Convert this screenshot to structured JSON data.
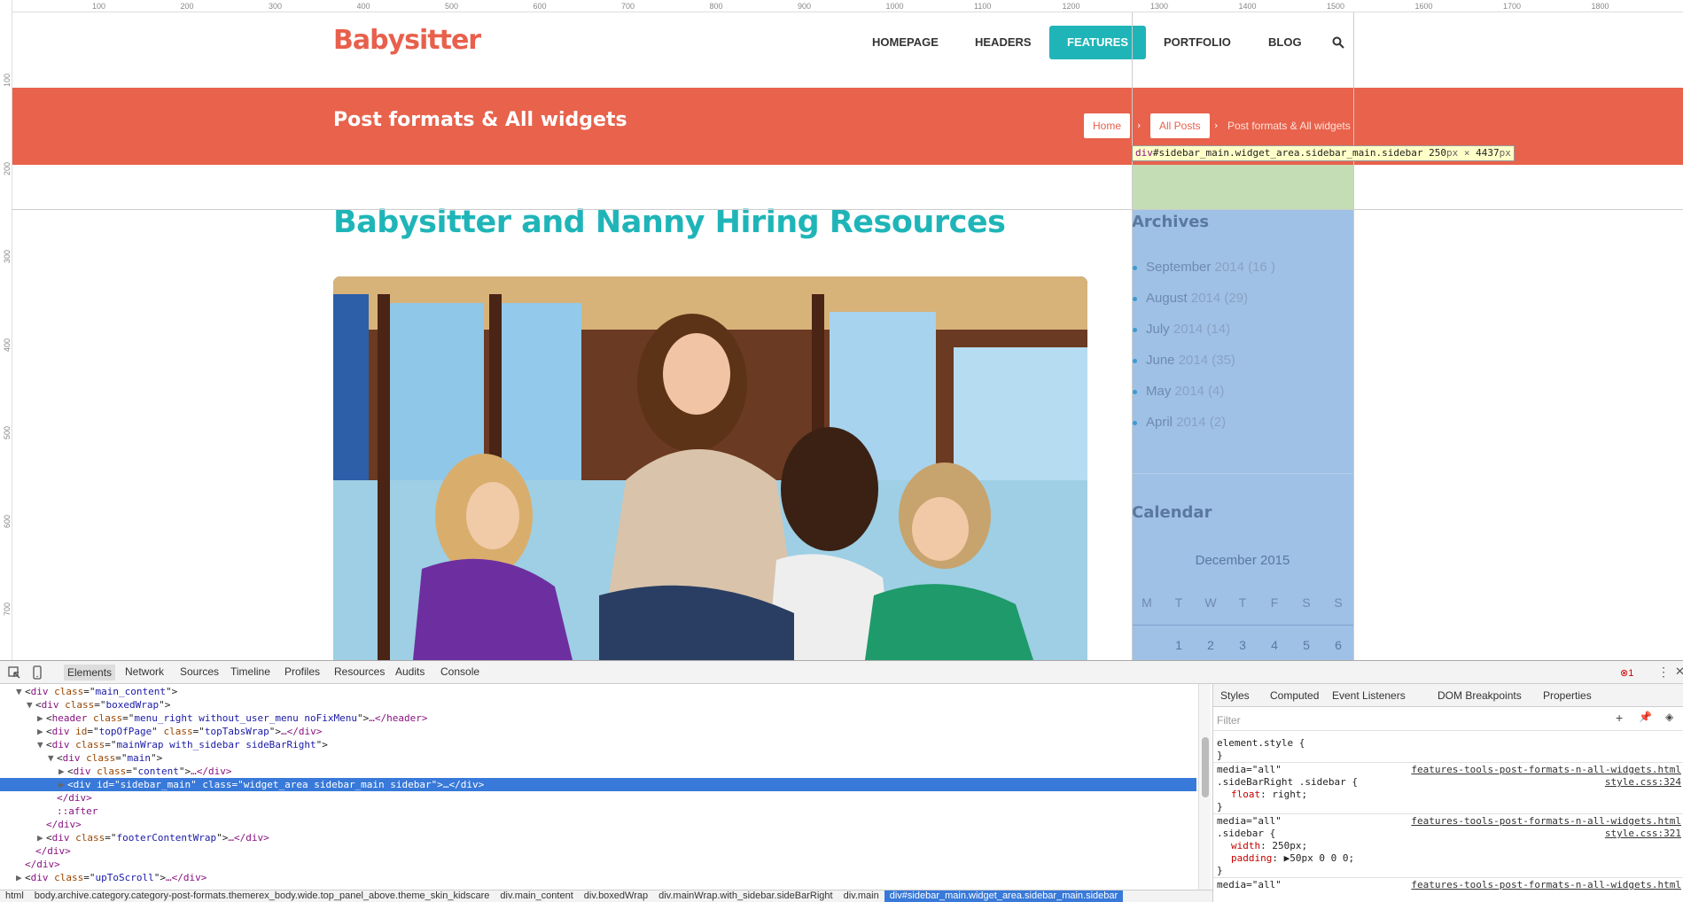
{
  "rulers": {
    "top": [
      "100",
      "200",
      "300",
      "400",
      "500",
      "600",
      "700",
      "800",
      "900",
      "1000",
      "1100",
      "1200",
      "1300",
      "1400",
      "1500",
      "1600",
      "1700",
      "1800"
    ],
    "left": [
      "100",
      "200",
      "300",
      "400",
      "500",
      "600",
      "700"
    ]
  },
  "site": {
    "logo": "Babysitter",
    "nav": [
      "HOMEPAGE",
      "HEADERS",
      "FEATURES",
      "PORTFOLIO",
      "BLOG"
    ],
    "active_nav": "FEATURES",
    "banner_title": "Post formats & All widgets",
    "breadcrumb": {
      "home": "Home",
      "all_posts": "All Posts",
      "sep": "›",
      "current": "Post formats & All widgets"
    }
  },
  "inspect_tooltip": {
    "tag": "div",
    "selector": "#sidebar_main.widget_area.sidebar_main.sidebar",
    "width": "250",
    "height": "4437",
    "unit": "px",
    "times": "×"
  },
  "post": {
    "title": "Babysitter and Nanny Hiring Resources"
  },
  "sidebar": {
    "archives_title": "Archives",
    "archives": [
      {
        "month": "September",
        "year": "2014",
        "count": "(16 )"
      },
      {
        "month": "August",
        "year": "2014",
        "count": "(29)"
      },
      {
        "month": "July",
        "year": "2014",
        "count": "(14)"
      },
      {
        "month": "June",
        "year": "2014",
        "count": "(35)"
      },
      {
        "month": "May",
        "year": "2014",
        "count": "(4)"
      },
      {
        "month": "April",
        "year": "2014",
        "count": "(2)"
      }
    ],
    "calendar_title": "Calendar",
    "calendar_month": "December 2015",
    "weekdays": [
      "M",
      "T",
      "W",
      "T",
      "F",
      "S",
      "S"
    ],
    "first_row": [
      "1",
      "2",
      "3",
      "4",
      "5",
      "6"
    ]
  },
  "devtools": {
    "tabs": [
      "Elements",
      "Network",
      "Sources",
      "Timeline",
      "Profiles",
      "Resources",
      "Audits",
      "Console"
    ],
    "error_count": "1",
    "dom": [
      {
        "i": 1,
        "tri": "▼",
        "t": "div",
        "a": "class",
        "v": "main_content",
        "tail": ""
      },
      {
        "i": 2,
        "tri": "▼",
        "t": "div",
        "a": "class",
        "v": "boxedWrap",
        "tail": ""
      },
      {
        "i": 3,
        "tri": "▶",
        "t": "header",
        "a": "class",
        "v": "menu_right without_user_menu noFixMenu",
        "tail": "…</header>"
      },
      {
        "i": 3,
        "tri": "▶",
        "t": "div",
        "a": "id",
        "v": "topOfPage",
        "a2": "class",
        "v2": "topTabsWrap",
        "tail": "…</div>"
      },
      {
        "i": 3,
        "tri": "▼",
        "t": "div",
        "a": "class",
        "v": "mainWrap with_sidebar sideBarRight",
        "tail": ""
      },
      {
        "i": 4,
        "tri": "▼",
        "t": "div",
        "a": "class",
        "v": "main",
        "tail": ""
      },
      {
        "i": 5,
        "tri": "▶",
        "t": "div",
        "a": "class",
        "v": "content",
        "tail": "…</div>"
      },
      {
        "i": 5,
        "tri": "▶",
        "t": "div",
        "a": "id",
        "v": "sidebar_main",
        "a2": "class",
        "v2": "widget_area sidebar_main sidebar",
        "tail": "…</div>",
        "sel": true
      },
      {
        "i": 4,
        "tri": "",
        "close": "</div>"
      },
      {
        "i": 4,
        "tri": "",
        "close": "::after"
      },
      {
        "i": 3,
        "tri": "",
        "close": "</div>"
      },
      {
        "i": 3,
        "tri": "▶",
        "t": "div",
        "a": "class",
        "v": "footerContentWrap",
        "tail": "…</div>"
      },
      {
        "i": 2,
        "tri": "",
        "close": "</div>"
      },
      {
        "i": 1,
        "tri": "",
        "close": "</div>"
      },
      {
        "i": 1,
        "tri": "▶",
        "t": "div",
        "a": "class",
        "v": "upToScroll",
        "tail": "…</div>"
      }
    ],
    "breadcrumbs": [
      "html",
      "body.archive.category.category-post-formats.themerex_body.wide.top_panel_above.theme_skin_kidscare",
      "div.main_content",
      "div.boxedWrap",
      "div.mainWrap.with_sidebar.sideBarRight",
      "div.main",
      "div#sidebar_main.widget_area.sidebar_main.sidebar"
    ],
    "styles_tabs": [
      "Styles",
      "Computed",
      "Event Listeners",
      "DOM Breakpoints",
      "Properties"
    ],
    "filter_placeholder": "Filter",
    "rules": [
      {
        "media": "",
        "selector": "element.style {",
        "props": [],
        "link1": "",
        "link2": ""
      },
      {
        "media": "media=\"all\"",
        "selector": ".sideBarRight .sidebar {",
        "props": [
          [
            "float",
            "right;"
          ]
        ],
        "link1": "features-tools-post-formats-n-all-widgets.html",
        "link2": "style.css:324"
      },
      {
        "media": "media=\"all\"",
        "selector": ".sidebar {",
        "props": [
          [
            "width",
            "250px;"
          ],
          [
            "padding",
            "▶50px 0 0 0;"
          ]
        ],
        "link1": "features-tools-post-formats-n-all-widgets.html",
        "link2": "style.css:321"
      }
    ],
    "truncated_media": "media=\"all\""
  },
  "colors": {
    "brand": "#e8604c",
    "accent": "#1fb5b8",
    "selection": "#3879d9"
  }
}
